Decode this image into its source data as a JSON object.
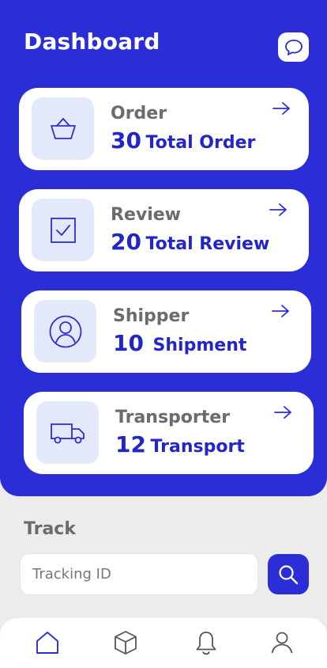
{
  "header": {
    "title": "Dashboard",
    "chat_icon": "chat-bubble-icon"
  },
  "cards": [
    {
      "label": "Order",
      "count": "30",
      "unit": "Total Order",
      "icon": "basket-icon"
    },
    {
      "label": "Review",
      "count": "20",
      "unit": "Total Review",
      "icon": "checkbox-icon"
    },
    {
      "label": "Shipper",
      "count": "10",
      "unit": "Shipment",
      "icon": "user-circle-icon"
    },
    {
      "label": "Transporter",
      "count": "12",
      "unit": "Transport",
      "icon": "truck-icon"
    }
  ],
  "track": {
    "title": "Track",
    "placeholder": "Tracking ID",
    "search_icon": "search-icon"
  },
  "nav": [
    {
      "name": "home",
      "icon": "home-icon"
    },
    {
      "name": "package",
      "icon": "box-icon"
    },
    {
      "name": "notifications",
      "icon": "bell-icon"
    },
    {
      "name": "profile",
      "icon": "user-icon"
    }
  ],
  "colors": {
    "primary": "#2b2ed6",
    "accent_text": "#2226c9",
    "icon_bg": "#e4e8fb",
    "muted_text": "#6b6b6b",
    "page_bg": "#ececec"
  }
}
